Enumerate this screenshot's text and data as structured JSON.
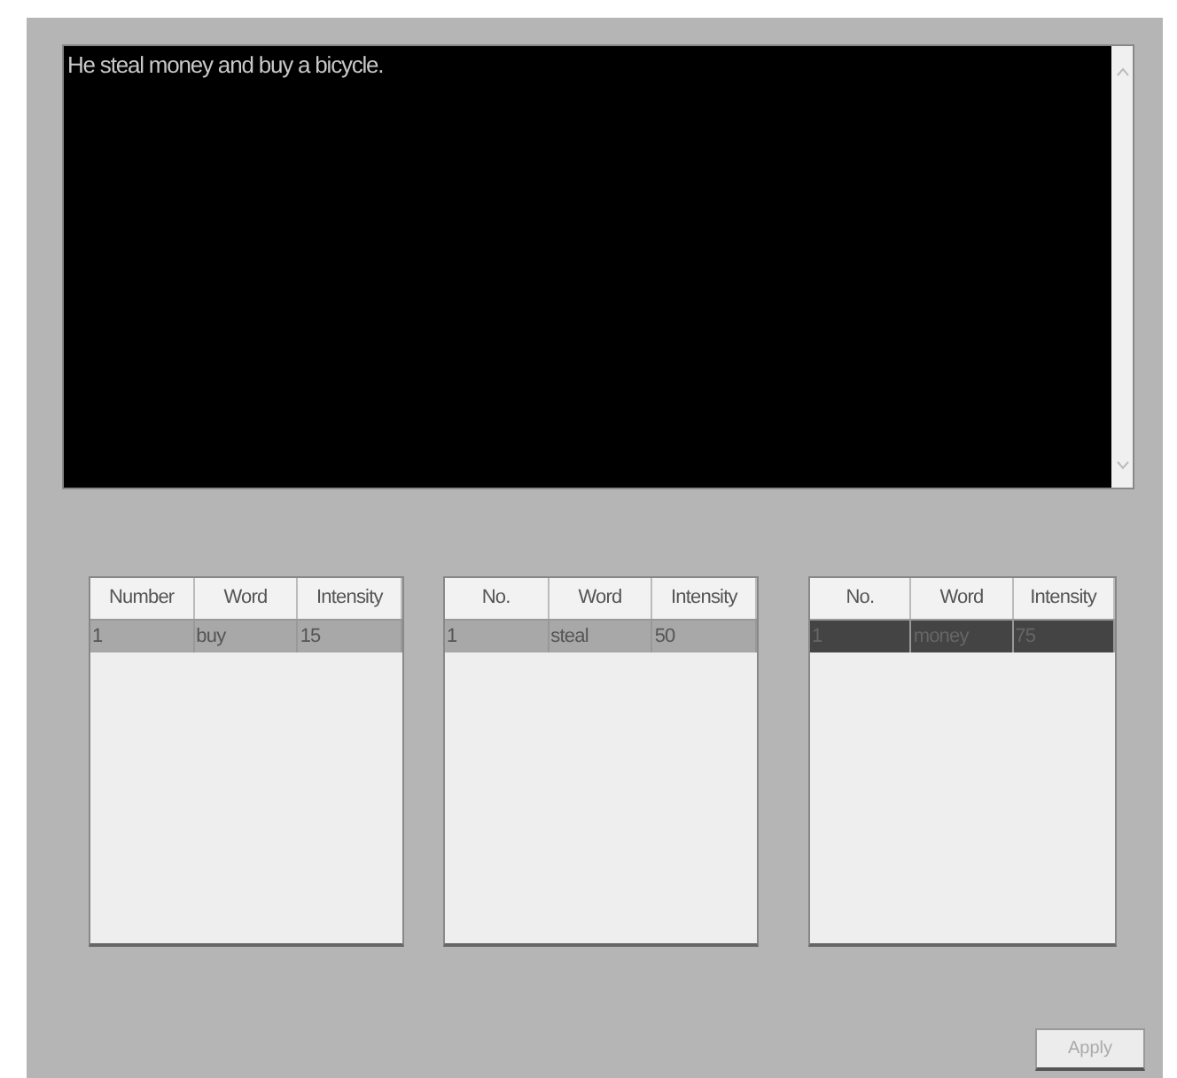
{
  "text_area": {
    "value": "He steal money and buy a bicycle."
  },
  "tables": [
    {
      "focused": false,
      "columns": [
        "Number",
        "Word",
        "Intensity"
      ],
      "rows": [
        {
          "cells": [
            "1",
            "buy",
            "15"
          ],
          "selected": true
        }
      ]
    },
    {
      "focused": false,
      "columns": [
        "No.",
        "Word",
        "Intensity"
      ],
      "rows": [
        {
          "cells": [
            "1",
            "steal",
            "50"
          ],
          "selected": true
        }
      ]
    },
    {
      "focused": true,
      "columns": [
        "No.",
        "Word",
        "Intensity"
      ],
      "rows": [
        {
          "cells": [
            "1",
            "money",
            "75"
          ],
          "selected": true
        }
      ]
    }
  ],
  "apply_button": {
    "label": "Apply",
    "disabled": true
  }
}
